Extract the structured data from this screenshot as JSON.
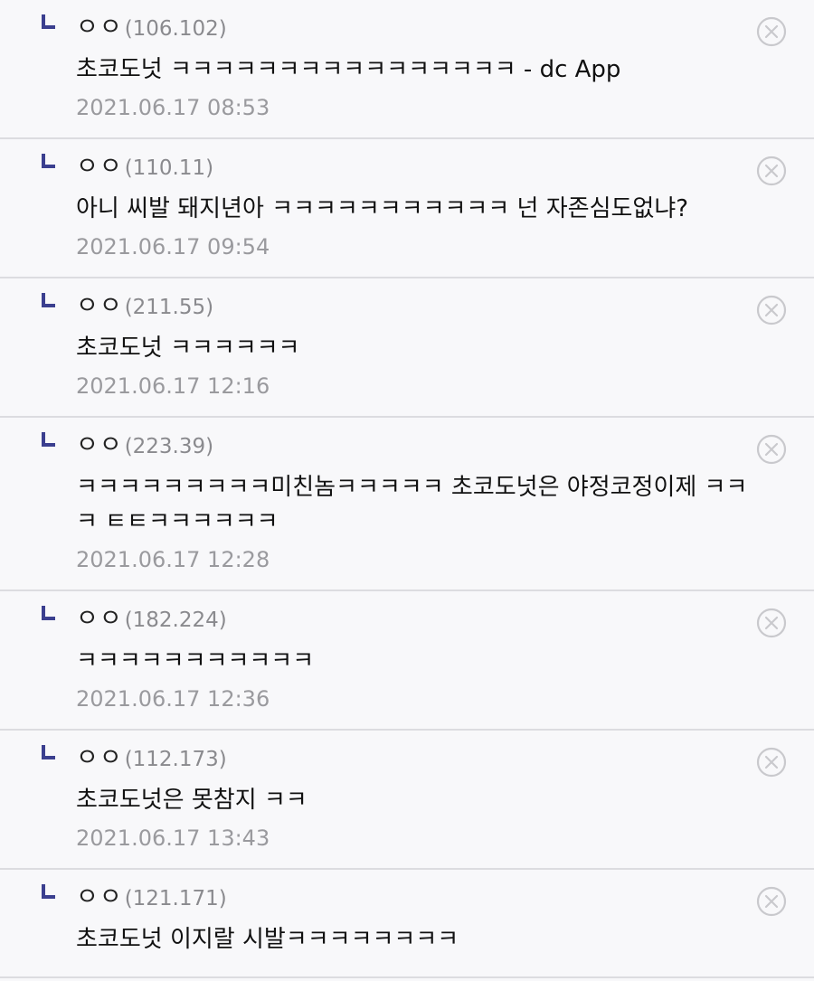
{
  "icons": {
    "reply": "reply-corner-icon",
    "delete": "close-circle-icon"
  },
  "colors": {
    "reply_mark": "#3b3f8f",
    "delete_icon": "#c9c9cd",
    "ip_text": "#8a8a8e",
    "time_text": "#9a9a9e"
  },
  "comments": [
    {
      "nick": "ㅇㅇ",
      "ip": "(106.102)",
      "text": "초코도넛 ㅋㅋㅋㅋㅋㅋㅋㅋㅋㅋㅋㅋㅋㅋㅋㅋ - dc App",
      "time": "2021.06.17 08:53"
    },
    {
      "nick": "ㅇㅇ",
      "ip": "(110.11)",
      "text": "아니 씨발 돼지년아 ㅋㅋㅋㅋㅋㅋㅋㅋㅋㅋㅋ 넌 자존심도없냐?",
      "time": "2021.06.17 09:54"
    },
    {
      "nick": "ㅇㅇ",
      "ip": "(211.55)",
      "text": "초코도넛 ㅋㅋㅋㅋㅋㅋ",
      "time": "2021.06.17 12:16"
    },
    {
      "nick": "ㅇㅇ",
      "ip": "(223.39)",
      "text": "ㅋㅋㅋㅋㅋㅋㅋㅋㅋ미친놈ㅋㅋㅋㅋㅋ 초코도넛은 야정코정이제 ㅋㅋㅋ ㅌㅌㅋㅋㅋㅋㅋㅋ",
      "time": "2021.06.17 12:28"
    },
    {
      "nick": "ㅇㅇ",
      "ip": "(182.224)",
      "text": "ㅋㅋㅋㅋㅋㅋㅋㅋㅋㅋㅋ",
      "time": "2021.06.17 12:36"
    },
    {
      "nick": "ㅇㅇ",
      "ip": "(112.173)",
      "text": "초코도넛은 못참지 ㅋㅋ",
      "time": "2021.06.17 13:43"
    },
    {
      "nick": "ㅇㅇ",
      "ip": "(121.171)",
      "text": "초코도넛 이지랄 시발ㅋㅋㅋㅋㅋㅋㅋㅋ",
      "time": ""
    }
  ]
}
